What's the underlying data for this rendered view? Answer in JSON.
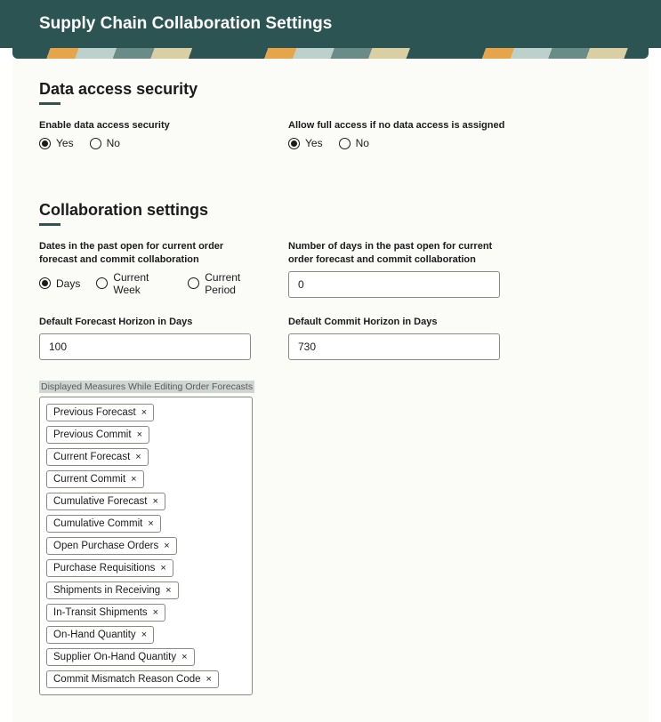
{
  "header": {
    "title": "Supply Chain Collaboration Settings"
  },
  "section1": {
    "title": "Data access security",
    "enable_label": "Enable data access security",
    "enable_options": {
      "yes": "Yes",
      "no": "No"
    },
    "allow_label": "Allow full access if no data access is assigned",
    "allow_options": {
      "yes": "Yes",
      "no": "No"
    }
  },
  "section2": {
    "title": "Collaboration settings",
    "dates_label": "Dates in the past open for current order forecast and commit collaboration",
    "dates_options": {
      "days": "Days",
      "week": "Current Week",
      "period": "Current Period"
    },
    "num_days_label": "Number of days in the past open for current order forecast and commit collaboration",
    "num_days_value": "0",
    "forecast_horizon_label": "Default Forecast Horizon in Days",
    "forecast_horizon_value": "100",
    "commit_horizon_label": "Default Commit Horizon in Days",
    "commit_horizon_value": "730",
    "measures_label": "Displayed Measures While Editing Order Forecasts",
    "measures": [
      "Previous Forecast",
      "Previous Commit",
      "Current Forecast",
      "Current Commit",
      "Cumulative Forecast",
      "Cumulative Commit",
      "Open Purchase Orders",
      "Purchase Requisitions",
      "Shipments in Receiving",
      "In-Transit Shipments",
      "On-Hand Quantity",
      "Supplier On-Hand Quantity",
      "Commit Mismatch Reason Code"
    ]
  }
}
